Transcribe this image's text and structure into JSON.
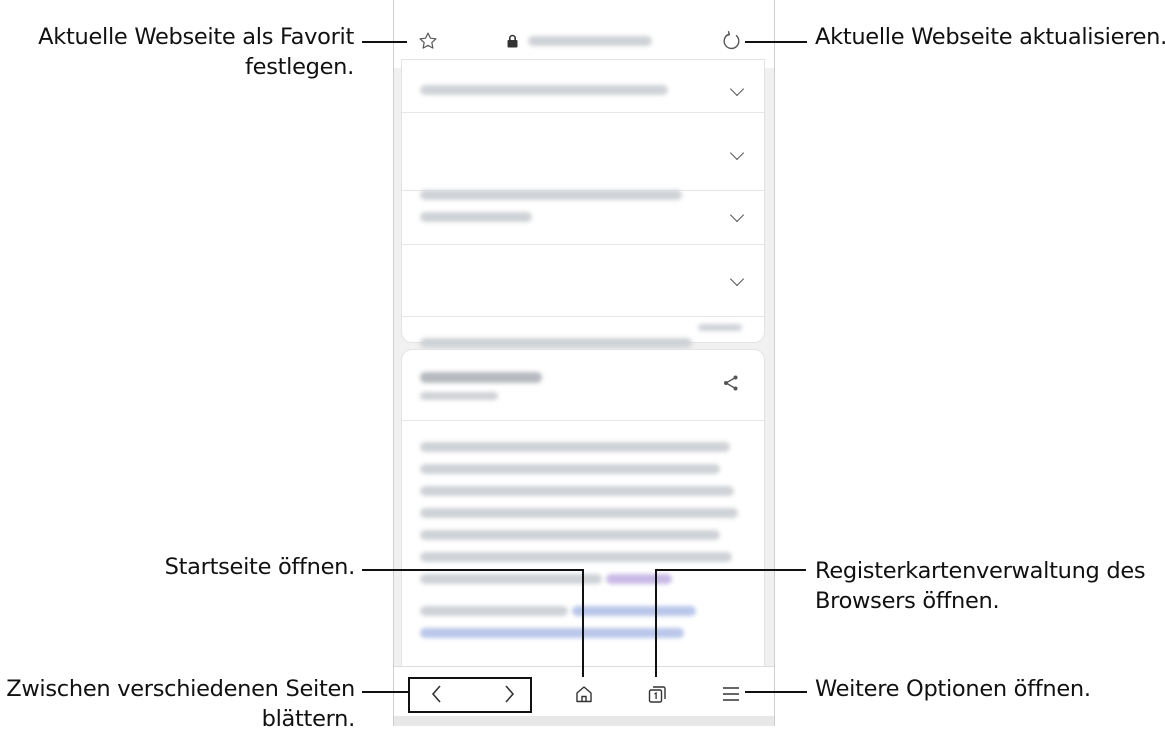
{
  "callouts": {
    "favorite": {
      "line1": "Aktuelle Webseite als Favorit",
      "line2": "festlegen."
    },
    "refresh": "Aktuelle Webseite aktualisieren.",
    "home": "Startseite öffnen.",
    "tabs": {
      "line1": "Registerkartenverwaltung des",
      "line2": "Browsers öffnen."
    },
    "navigate": {
      "line1": "Zwischen verschiedenen Seiten",
      "line2": "blättern."
    },
    "menu": "Weitere Optionen öffnen."
  },
  "icons": {
    "favorite": "star-outline-icon",
    "secure": "lock-icon",
    "refresh": "refresh-icon",
    "back": "chevron-left-icon",
    "forward": "chevron-right-icon",
    "home": "home-icon",
    "tabs": "tabs-icon",
    "menu": "menu-icon",
    "share": "share-icon",
    "expand": "chevron-down-icon"
  },
  "colors": {
    "callout_text": "#111111",
    "leader_line": "#111111",
    "screen_background": "#f1f1f1",
    "card_background": "#ffffff",
    "icon_gray": "#555555"
  }
}
